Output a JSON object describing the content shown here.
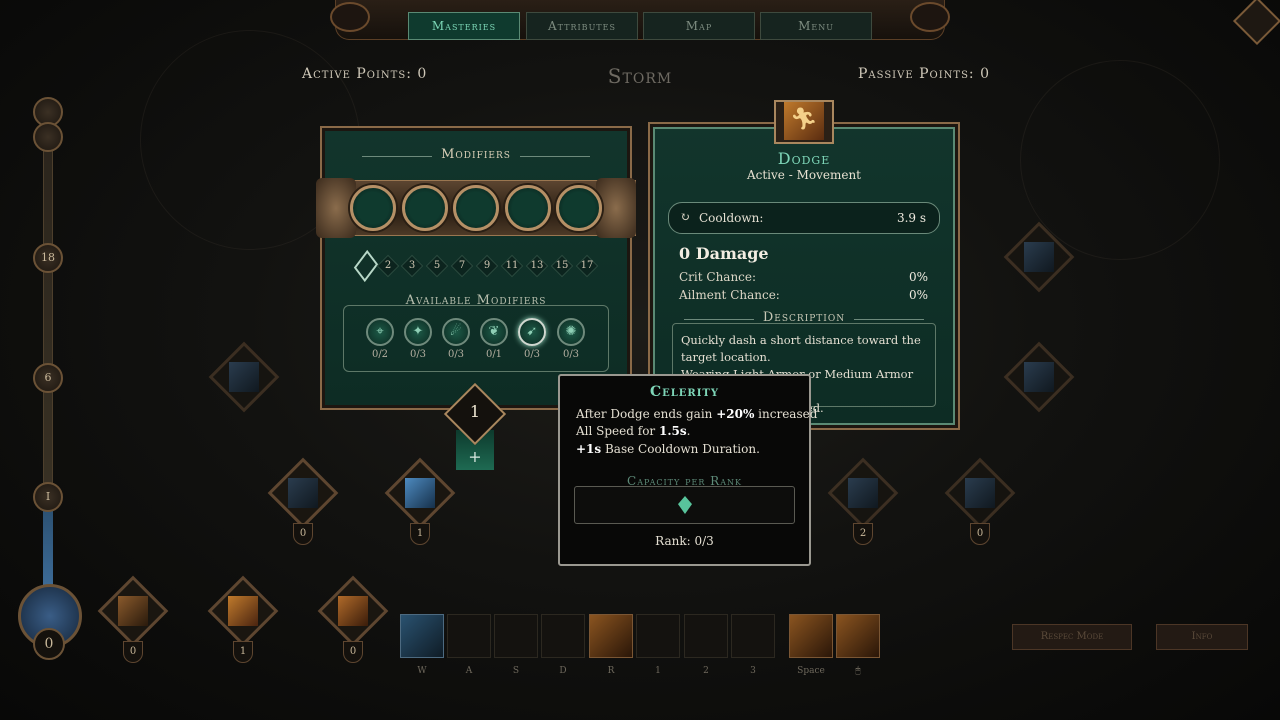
{
  "nav": {
    "tabs": [
      {
        "label": "Masteries",
        "active": true
      },
      {
        "label": "Attributes",
        "active": false
      },
      {
        "label": "Map",
        "active": false
      },
      {
        "label": "Menu",
        "active": false
      }
    ]
  },
  "header": {
    "active_points_label": "Active Points:",
    "active_points_value": "0",
    "mastery_title": "Storm",
    "passive_points_label": "Passive Points:",
    "passive_points_value": "0"
  },
  "progress_track": {
    "nodes": [
      "18",
      "6",
      "I"
    ],
    "points": "0"
  },
  "modifiers_panel": {
    "title": "Modifiers",
    "rank_thresholds": [
      "2",
      "3",
      "5",
      "7",
      "9",
      "11",
      "13",
      "15",
      "17"
    ],
    "available_title": "Available Modifiers",
    "available": [
      {
        "icon": "crosshair-icon",
        "glyph": "⌖",
        "count": "0/2"
      },
      {
        "icon": "wind-figure-icon",
        "glyph": "✦",
        "count": "0/3"
      },
      {
        "icon": "runner-icon",
        "glyph": "☄",
        "count": "0/3"
      },
      {
        "icon": "feather-icon",
        "glyph": "❦",
        "count": "0/1"
      },
      {
        "icon": "celerity-icon",
        "glyph": "➹",
        "count": "0/3",
        "hovered": true
      },
      {
        "icon": "gear-burst-icon",
        "glyph": "✺",
        "count": "0/3"
      }
    ],
    "skill_points": "1",
    "add_symbol": "+"
  },
  "skill_panel": {
    "name": "Dodge",
    "type": "Active - Movement",
    "cooldown_label": "Cooldown:",
    "cooldown_value": "3.9 s",
    "damage": "0 Damage",
    "crit_label": "Crit Chance:",
    "crit_value": "0%",
    "ailment_label": "Ailment Chance:",
    "ailment_value": "0%",
    "description_title": "Description",
    "description_line1": "Quickly dash a short distance toward the target location.",
    "description_line2": "Wearing Light Armor or Medium Armor grants",
    "description_line3": "Dodge Cooldown Speed."
  },
  "tooltip": {
    "title": "Celerity",
    "line1_pre": "After Dodge ends gain ",
    "line1_bold": "+20%",
    "line1_post": " increased",
    "line2_pre": "All Speed for ",
    "line2_bold": "1.5s",
    "line2_post": ".",
    "line3_bold": "+1s",
    "line3_post": " Base Cooldown Duration.",
    "capacity_title": "Capacity per Rank",
    "rank": "Rank: 0/3"
  },
  "skill_tree": {
    "nodes": [
      {
        "name": "skill-node-ice-column",
        "count": "0"
      },
      {
        "name": "skill-node-frost-pillar",
        "count": "1"
      },
      {
        "name": "skill-node-storm-orb",
        "count": "2"
      },
      {
        "name": "skill-node-gale",
        "count": "0"
      }
    ],
    "bottom_nodes": [
      {
        "name": "skill-node-crossbow",
        "count": "0"
      },
      {
        "name": "skill-node-dodge",
        "count": "1"
      },
      {
        "name": "skill-node-vortex",
        "count": "0"
      }
    ]
  },
  "hotbar": {
    "keys": [
      "W",
      "A",
      "S",
      "D",
      "R",
      "1",
      "2",
      "3",
      "Space"
    ],
    "respec_label": "Respec Mode",
    "info_label": "Info"
  }
}
